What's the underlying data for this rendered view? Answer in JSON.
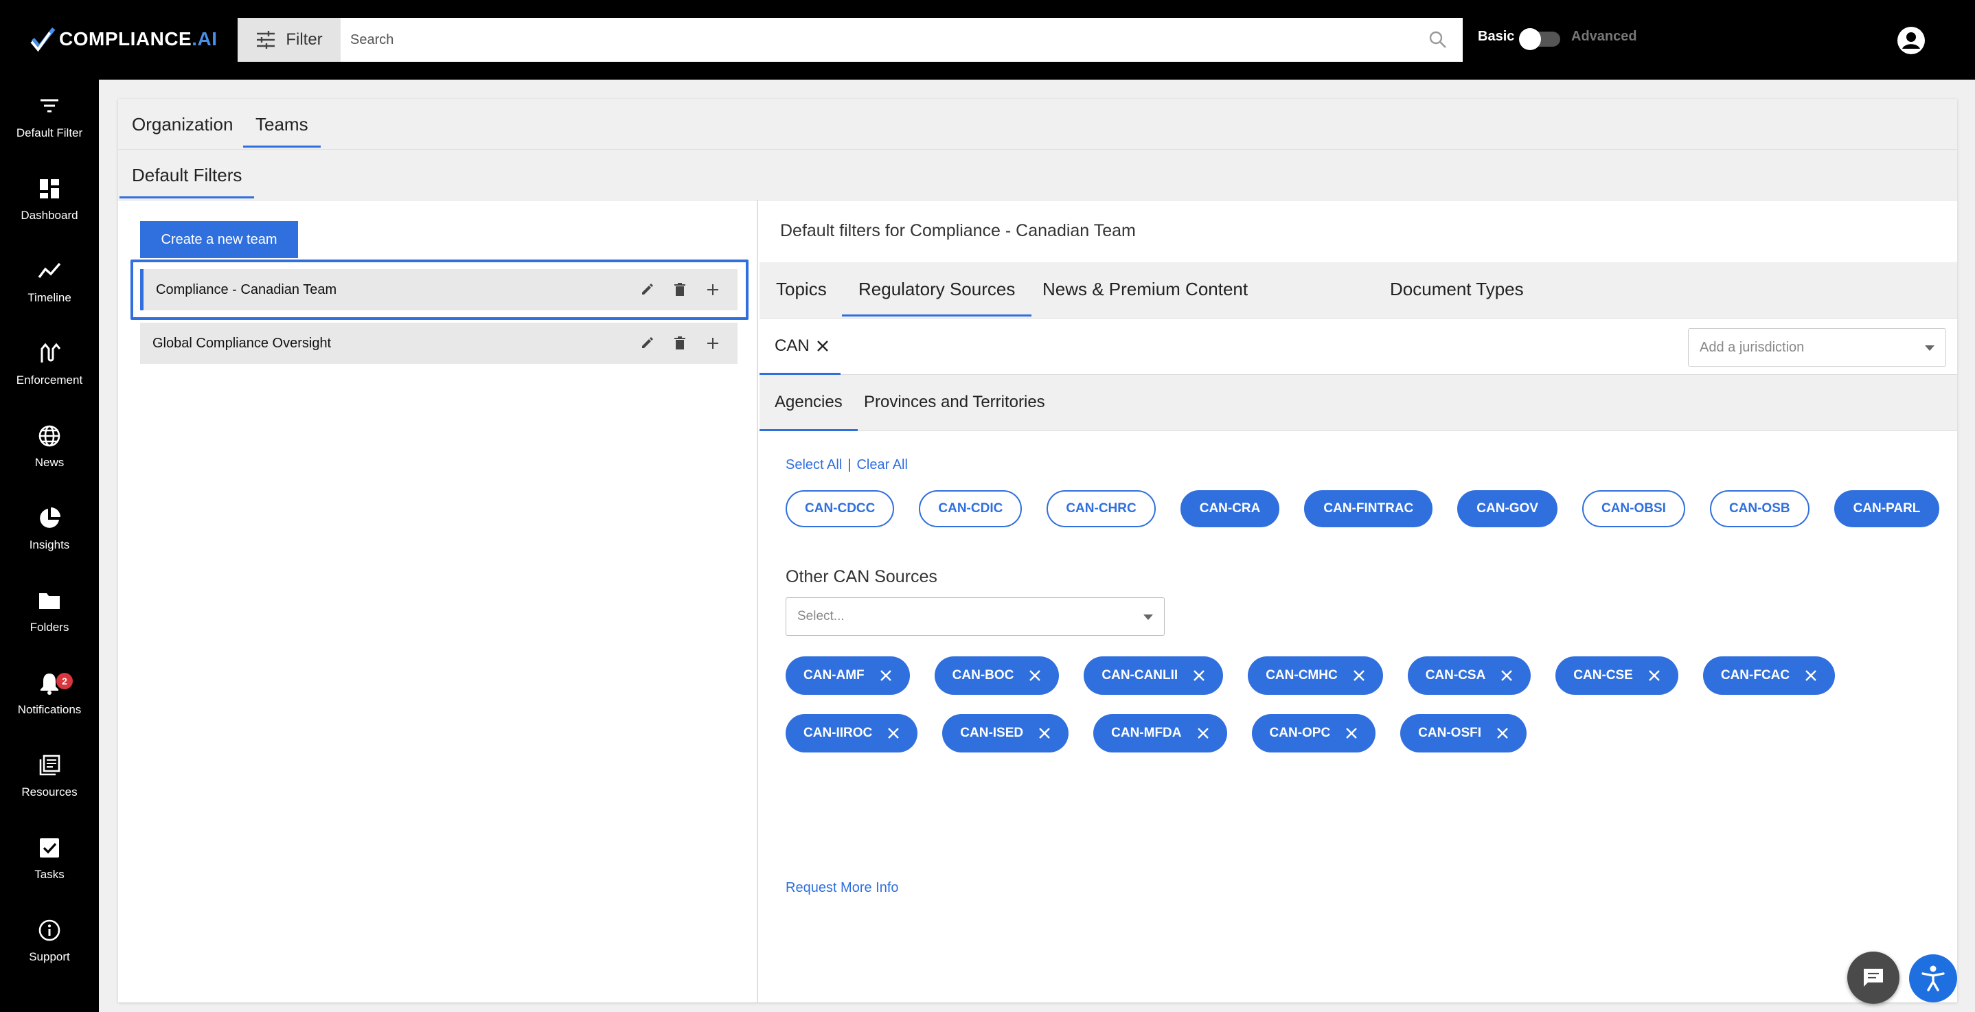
{
  "app": {
    "logo_text": "COMPLIANCE",
    "logo_suffix": ".AI",
    "filter_label": "Filter",
    "search_placeholder": "Search",
    "mode_basic": "Basic",
    "mode_advanced": "Advanced"
  },
  "sidebar": {
    "items": [
      {
        "label": "Default Filter",
        "icon": "filter-lines-icon"
      },
      {
        "label": "Dashboard",
        "icon": "dashboard-icon"
      },
      {
        "label": "Timeline",
        "icon": "timeline-icon"
      },
      {
        "label": "Enforcement",
        "icon": "enforcement-icon"
      },
      {
        "label": "News",
        "icon": "globe-icon"
      },
      {
        "label": "Insights",
        "icon": "pie-chart-icon"
      },
      {
        "label": "Folders",
        "icon": "folder-icon"
      },
      {
        "label": "Notifications",
        "icon": "bell-icon",
        "badge": "2"
      },
      {
        "label": "Resources",
        "icon": "resources-icon"
      },
      {
        "label": "Tasks",
        "icon": "checkbox-icon"
      },
      {
        "label": "Support",
        "icon": "info-icon"
      }
    ]
  },
  "top_tabs": {
    "organization": "Organization",
    "teams": "Teams"
  },
  "sub_tab": "Default Filters",
  "teams_panel": {
    "create_label": "Create a new team",
    "teams": [
      "Compliance - Canadian Team",
      "Global Compliance Oversight"
    ]
  },
  "filters_panel": {
    "title": "Default filters for Compliance - Canadian Team",
    "tabs": [
      "Topics",
      "Regulatory Sources",
      "News & Premium Content",
      "Document Types"
    ],
    "jurisdiction_chip": "CAN",
    "jurisdiction_placeholder": "Add a jurisdiction",
    "sub_tabs": [
      "Agencies",
      "Provinces and Territories"
    ],
    "select_all": "Select All",
    "separator": "|",
    "clear_all": "Clear All",
    "agencies": [
      {
        "label": "CAN-CDCC",
        "selected": false
      },
      {
        "label": "CAN-CDIC",
        "selected": false
      },
      {
        "label": "CAN-CHRC",
        "selected": false
      },
      {
        "label": "CAN-CRA",
        "selected": true
      },
      {
        "label": "CAN-FINTRAC",
        "selected": true
      },
      {
        "label": "CAN-GOV",
        "selected": true
      },
      {
        "label": "CAN-OBSI",
        "selected": false
      },
      {
        "label": "CAN-OSB",
        "selected": false
      },
      {
        "label": "CAN-PARL",
        "selected": true
      }
    ],
    "other_label": "Other CAN Sources",
    "other_placeholder": "Select...",
    "other_sources_row1": [
      "CAN-AMF",
      "CAN-BOC",
      "CAN-CANLII",
      "CAN-CMHC",
      "CAN-CSA",
      "CAN-CSE",
      "CAN-FCAC"
    ],
    "other_sources_row2": [
      "CAN-IIROC",
      "CAN-ISED",
      "CAN-MFDA",
      "CAN-OPC",
      "CAN-OSFI"
    ],
    "request_info": "Request More Info"
  },
  "colors": {
    "accent": "#2f6fde",
    "badge": "#d9363e",
    "topbar": "#000000"
  }
}
